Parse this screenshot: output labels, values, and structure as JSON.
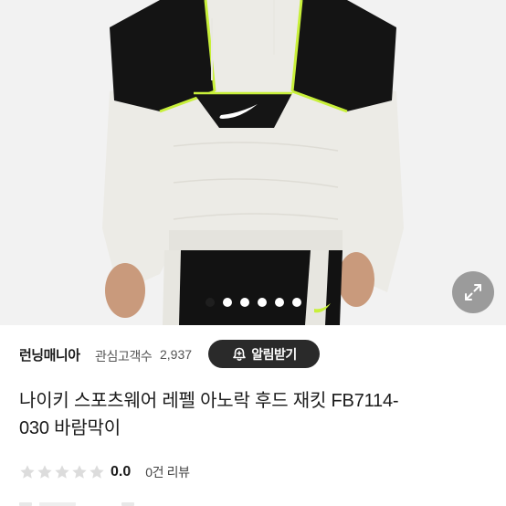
{
  "carousel": {
    "dot_count": 6,
    "active_index": 0
  },
  "seller": {
    "name": "런닝매니아",
    "follower_label": "관심고객수",
    "follower_count": "2,937",
    "notify_button_label": "알림받기"
  },
  "product": {
    "title_line1": "나이키 스포츠웨어 레펠 아노락 후드 재킷 FB7114-",
    "title_line2": "030 바람막이"
  },
  "rating": {
    "score": "0.0",
    "review_count_label": "0건 리뷰",
    "stars_filled": 0,
    "stars_total": 5
  },
  "icons": {
    "expand": "expand-arrows-icon",
    "bell": "bell-plus-icon",
    "star": "star-icon"
  },
  "colors": {
    "accent_dark": "#2a2a2a",
    "star_empty": "#dcdcdc",
    "neon": "#c8f03a"
  }
}
